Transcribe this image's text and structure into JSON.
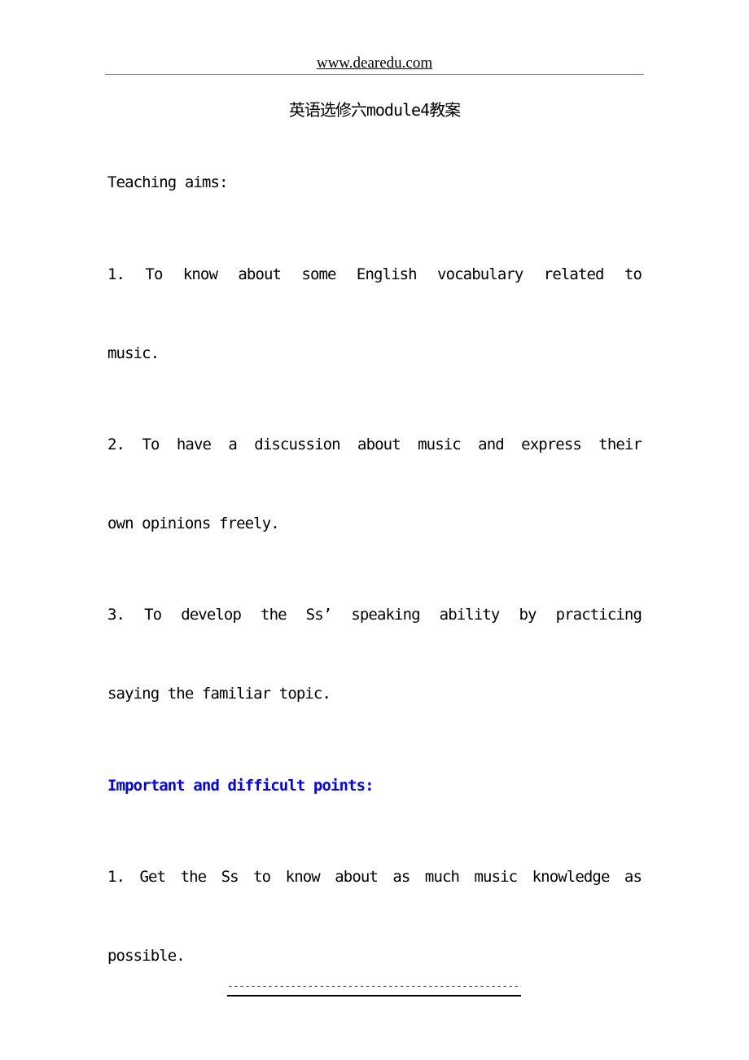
{
  "header": {
    "site": "www.dearedu.com"
  },
  "document": {
    "title": "英语选修六module4教案",
    "teaching_aims": {
      "heading": "Teaching aims:",
      "items": [
        {
          "line1": "1.  To  know  about  some  English  vocabulary  related  to",
          "line2": "music."
        },
        {
          "line1": "2.  To have a discussion about music and express their",
          "line2": "own opinions freely."
        },
        {
          "line1": "3.  To develop the Ss’  speaking ability by practicing",
          "line2": "saying the familiar topic."
        }
      ]
    },
    "important_points": {
      "heading": "Important and difficult points:",
      "heading_color": "#0000FF",
      "items": [
        {
          "line1": "1. Get the Ss to know about as much music knowledge as",
          "line2": "possible."
        }
      ]
    }
  },
  "footer": {
    "dashes": "--------------------------------------------------------------"
  }
}
